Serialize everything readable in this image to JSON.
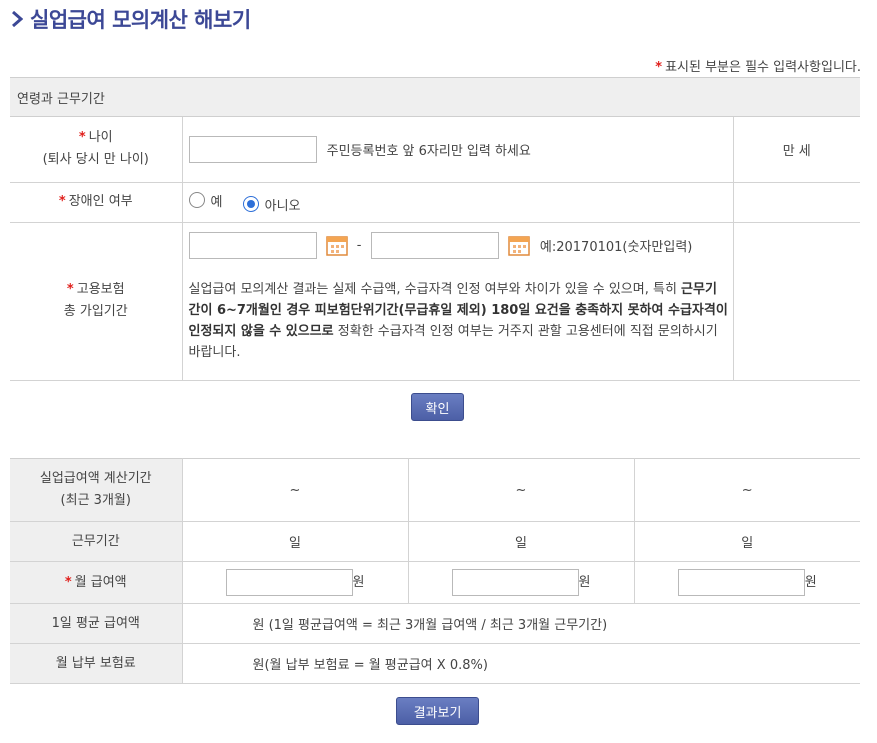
{
  "page": {
    "title": "실업급여 모의계산 해보기"
  },
  "required_note": "표시된 부분은 필수 입력사항입니다.",
  "required_mark": "*",
  "section1": {
    "title": "연령과 근무기간"
  },
  "age": {
    "label": "나이",
    "sublabel": "(퇴사 당시 만 나이)",
    "input_value": "",
    "help": "주민등록번호 앞 6자리만 입력 하세요",
    "unit": "만 세"
  },
  "disability": {
    "label": "장애인 여부",
    "options": [
      {
        "label": "예",
        "selected": false
      },
      {
        "label": "아니오",
        "selected": true
      }
    ]
  },
  "insurance": {
    "label_line1": "고용보험",
    "label_line2": "총 가입기간",
    "start_value": "",
    "end_value": "",
    "separator": "-",
    "example": "예:20170101(숫자만입력)",
    "notice_part1": "실업급여 모의계산 결과는 실제 수급액, 수급자격 인정 여부와 차이가 있을 수 있으며, 특히 ",
    "notice_bold": "근무기간이 6~7개월인 경우 피보험단위기간(무급휴일 제외) 180일 요건을 충족하지 못하여 수급자격이 인정되지 않을 수 있으므로",
    "notice_part2": " 정확한 수급자격 인정 여부는 거주지 관할 고용센터에 직접 문의하시기 바랍니다."
  },
  "confirm_button": "확인",
  "calc": {
    "period_label": "실업급여액 계산기간",
    "period_sublabel": "(최근 3개월)",
    "period_values": [
      "~",
      "~",
      "~"
    ],
    "work_label": "근무기간",
    "work_unit": "일",
    "wage_label": "월 급여액",
    "wage_unit": "원",
    "daily_label": "1일 평균 급여액",
    "daily_formula": "원 (1일 평균급여액 = 최근 3개월 급여액 / 최근 3개월 근무기간)",
    "premium_label": "월 납부 보험료",
    "premium_formula": "원(월 납부 보험료 = 월 평균급여 X 0.8%)"
  },
  "result_button": "결과보기",
  "colors": {
    "title": "#3c4896",
    "required": "#e0201c",
    "button": "#4c5fa6",
    "header_bg": "#efefef"
  },
  "icons": {
    "title": "chevron-right-icon",
    "calendar": "calendar-icon",
    "radio": "radio-icon"
  }
}
